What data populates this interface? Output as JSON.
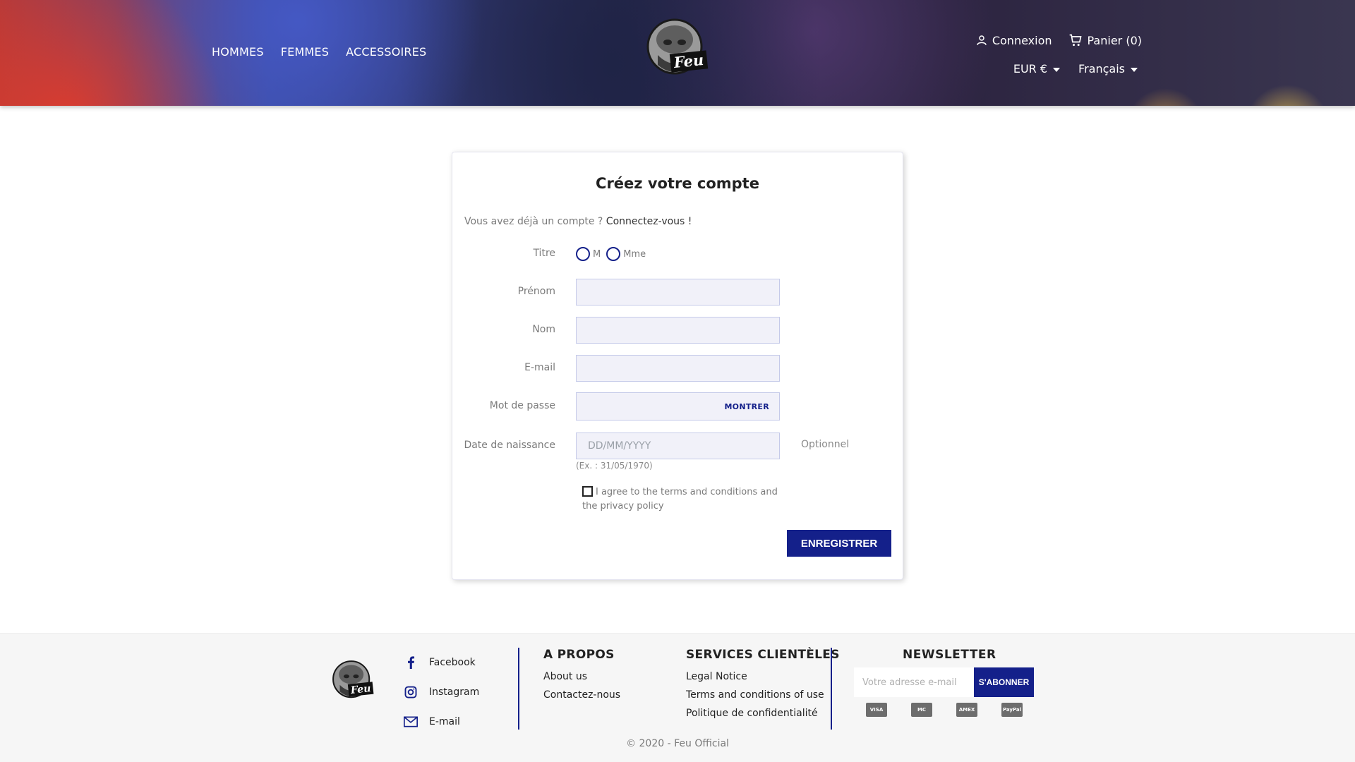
{
  "header": {
    "nav": [
      "HOMMES",
      "FEMMES",
      "ACCESSOIRES"
    ],
    "logo_text": "Feu",
    "login": "Connexion",
    "cart": "Panier (0)",
    "currency": "EUR €",
    "language": "Français"
  },
  "form": {
    "title": "Créez votre compte",
    "have_account": "Vous avez déjà un compte ?",
    "login_link": "Connectez-vous !",
    "labels": {
      "title": "Titre",
      "firstname": "Prénom",
      "lastname": "Nom",
      "email": "E-mail",
      "password": "Mot de passe",
      "birthday": "Date de naissance"
    },
    "radio_m": "M",
    "radio_mme": "Mme",
    "show_password": "MONTRER",
    "birthday_placeholder": "DD/MM/YYYY",
    "optional": "Optionnel",
    "birthday_hint": "(Ex. : 31/05/1970)",
    "agree_text": "I agree to the terms and conditions and the privacy policy",
    "submit": "ENREGISTRER"
  },
  "footer": {
    "logo_text": "Feu",
    "social": [
      "Facebook",
      "Instagram",
      "E-mail"
    ],
    "about": {
      "title": "A PROPOS",
      "links": [
        "About us",
        "Contactez-nous"
      ]
    },
    "services": {
      "title": "SERVICES CLIENTÈLES",
      "links": [
        "Legal Notice",
        "Terms and conditions of use",
        "Politique de confidentialité"
      ]
    },
    "newsletter": {
      "title": "NEWSLETTER",
      "placeholder": "Votre adresse e-mail",
      "button": "S'ABONNER"
    },
    "payments": [
      "VISA",
      "MC",
      "AMEX",
      "PayPal"
    ],
    "copyright": "© 2020 - Feu Official"
  },
  "colors": {
    "accent": "#14208a",
    "field_bg": "#f1f1f9"
  }
}
